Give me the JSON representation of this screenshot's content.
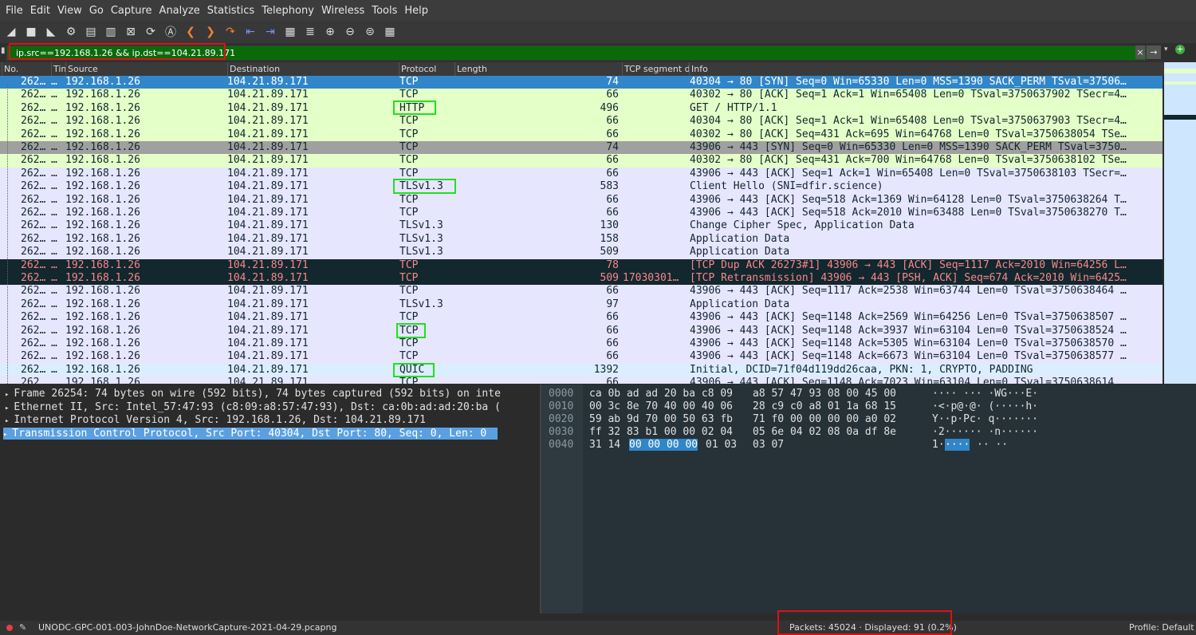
{
  "menu": [
    "File",
    "Edit",
    "View",
    "Go",
    "Capture",
    "Analyze",
    "Statistics",
    "Telephony",
    "Wireless",
    "Tools",
    "Help"
  ],
  "toolbar_icons": [
    "shark-fin-start-icon",
    "stop-icon",
    "restart-icon",
    "options-icon",
    "open-icon",
    "save-icon",
    "close-file-icon",
    "reload-icon",
    "find-icon",
    "back-icon",
    "forward-icon",
    "go-to-packet-icon",
    "first-packet-icon",
    "last-packet-icon",
    "autoscroll-icon",
    "colorize-icon",
    "zoom-in-icon",
    "zoom-out-icon",
    "normal-size-icon",
    "resize-columns-icon"
  ],
  "filter": {
    "value": "ip.src==192.168.1.26 && ip.dst==104.21.89.171",
    "clear": "×",
    "apply": "→",
    "add": "+"
  },
  "columns": [
    "No.",
    "Time",
    "Source",
    "Destination",
    "Protocol",
    "Length",
    "TCP segment data",
    "Info"
  ],
  "packets": [
    {
      "no": "262…",
      "time": "…",
      "src": "192.168.1.26",
      "dst": "104.21.89.171",
      "proto": "TCP",
      "len": "74",
      "seg": "",
      "info": "40304 → 80 [SYN] Seq=0 Win=65330 Len=0 MSS=1390 SACK_PERM TSval=37506…",
      "style": "sel"
    },
    {
      "no": "262…",
      "time": "…",
      "src": "192.168.1.26",
      "dst": "104.21.89.171",
      "proto": "TCP",
      "len": "66",
      "seg": "",
      "info": "40302 → 80 [ACK] Seq=1 Ack=1 Win=65408 Len=0 TSval=3750637902 TSecr=4…",
      "style": "green"
    },
    {
      "no": "262…",
      "time": "…",
      "src": "192.168.1.26",
      "dst": "104.21.89.171",
      "proto": "HTTP",
      "len": "496",
      "seg": "",
      "info": "GET / HTTP/1.1",
      "style": "green"
    },
    {
      "no": "262…",
      "time": "…",
      "src": "192.168.1.26",
      "dst": "104.21.89.171",
      "proto": "TCP",
      "len": "66",
      "seg": "",
      "info": "40304 → 80 [ACK] Seq=1 Ack=1 Win=65408 Len=0 TSval=3750637903 TSecr=4…",
      "style": "green"
    },
    {
      "no": "262…",
      "time": "…",
      "src": "192.168.1.26",
      "dst": "104.21.89.171",
      "proto": "TCP",
      "len": "66",
      "seg": "",
      "info": "40302 → 80 [ACK] Seq=431 Ack=695 Win=64768 Len=0 TSval=3750638054 TSe…",
      "style": "green"
    },
    {
      "no": "262…",
      "time": "…",
      "src": "192.168.1.26",
      "dst": "104.21.89.171",
      "proto": "TCP",
      "len": "74",
      "seg": "",
      "info": "43906 → 443 [SYN] Seq=0 Win=65330 Len=0 MSS=1390 SACK_PERM TSval=3750…",
      "style": "gray"
    },
    {
      "no": "262…",
      "time": "…",
      "src": "192.168.1.26",
      "dst": "104.21.89.171",
      "proto": "TCP",
      "len": "66",
      "seg": "",
      "info": "40302 → 80 [ACK] Seq=431 Ack=700 Win=64768 Len=0 TSval=3750638102 TSe…",
      "style": "green"
    },
    {
      "no": "262…",
      "time": "…",
      "src": "192.168.1.26",
      "dst": "104.21.89.171",
      "proto": "TCP",
      "len": "66",
      "seg": "",
      "info": "43906 → 443 [ACK] Seq=1 Ack=1 Win=65408 Len=0 TSval=3750638103 TSecr=…",
      "style": "lav"
    },
    {
      "no": "262…",
      "time": "…",
      "src": "192.168.1.26",
      "dst": "104.21.89.171",
      "proto": "TLSv1.3",
      "len": "583",
      "seg": "",
      "info": "Client Hello (SNI=dfir.science)",
      "style": "lav"
    },
    {
      "no": "262…",
      "time": "…",
      "src": "192.168.1.26",
      "dst": "104.21.89.171",
      "proto": "TCP",
      "len": "66",
      "seg": "",
      "info": "43906 → 443 [ACK] Seq=518 Ack=1369 Win=64128 Len=0 TSval=3750638264 T…",
      "style": "lav"
    },
    {
      "no": "262…",
      "time": "…",
      "src": "192.168.1.26",
      "dst": "104.21.89.171",
      "proto": "TCP",
      "len": "66",
      "seg": "",
      "info": "43906 → 443 [ACK] Seq=518 Ack=2010 Win=63488 Len=0 TSval=3750638270 T…",
      "style": "lav"
    },
    {
      "no": "262…",
      "time": "…",
      "src": "192.168.1.26",
      "dst": "104.21.89.171",
      "proto": "TLSv1.3",
      "len": "130",
      "seg": "",
      "info": "Change Cipher Spec, Application Data",
      "style": "lav"
    },
    {
      "no": "262…",
      "time": "…",
      "src": "192.168.1.26",
      "dst": "104.21.89.171",
      "proto": "TLSv1.3",
      "len": "158",
      "seg": "",
      "info": "Application Data",
      "style": "lav"
    },
    {
      "no": "262…",
      "time": "…",
      "src": "192.168.1.26",
      "dst": "104.21.89.171",
      "proto": "TLSv1.3",
      "len": "509",
      "seg": "",
      "info": "Application Data",
      "style": "lav"
    },
    {
      "no": "262…",
      "time": "…",
      "src": "192.168.1.26",
      "dst": "104.21.89.171",
      "proto": "TCP",
      "len": "78",
      "seg": "",
      "info": "[TCP Dup ACK 26273#1] 43906 → 443 [ACK] Seq=1117 Ack=2010 Win=64256 L…",
      "style": "dark"
    },
    {
      "no": "262…",
      "time": "…",
      "src": "192.168.1.26",
      "dst": "104.21.89.171",
      "proto": "TCP",
      "len": "509",
      "seg": "17030301…",
      "info": "[TCP Retransmission] 43906 → 443 [PSH, ACK] Seq=674 Ack=2010 Win=6425…",
      "style": "dark"
    },
    {
      "no": "262…",
      "time": "…",
      "src": "192.168.1.26",
      "dst": "104.21.89.171",
      "proto": "TCP",
      "len": "66",
      "seg": "",
      "info": "43906 → 443 [ACK] Seq=1117 Ack=2538 Win=63744 Len=0 TSval=3750638464 …",
      "style": "lav"
    },
    {
      "no": "262…",
      "time": "…",
      "src": "192.168.1.26",
      "dst": "104.21.89.171",
      "proto": "TLSv1.3",
      "len": "97",
      "seg": "",
      "info": "Application Data",
      "style": "lav"
    },
    {
      "no": "262…",
      "time": "…",
      "src": "192.168.1.26",
      "dst": "104.21.89.171",
      "proto": "TCP",
      "len": "66",
      "seg": "",
      "info": "43906 → 443 [ACK] Seq=1148 Ack=2569 Win=64256 Len=0 TSval=3750638507 …",
      "style": "lav"
    },
    {
      "no": "262…",
      "time": "…",
      "src": "192.168.1.26",
      "dst": "104.21.89.171",
      "proto": "TCP",
      "len": "66",
      "seg": "",
      "info": "43906 → 443 [ACK] Seq=1148 Ack=3937 Win=63104 Len=0 TSval=3750638524 …",
      "style": "lav"
    },
    {
      "no": "262…",
      "time": "…",
      "src": "192.168.1.26",
      "dst": "104.21.89.171",
      "proto": "TCP",
      "len": "66",
      "seg": "",
      "info": "43906 → 443 [ACK] Seq=1148 Ack=5305 Win=63104 Len=0 TSval=3750638570 …",
      "style": "lav"
    },
    {
      "no": "262…",
      "time": "…",
      "src": "192.168.1.26",
      "dst": "104.21.89.171",
      "proto": "TCP",
      "len": "66",
      "seg": "",
      "info": "43906 → 443 [ACK] Seq=1148 Ack=6673 Win=63104 Len=0 TSval=3750638577 …",
      "style": "lav"
    },
    {
      "no": "262…",
      "time": "…",
      "src": "192.168.1.26",
      "dst": "104.21.89.171",
      "proto": "QUIC",
      "len": "1392",
      "seg": "",
      "info": "Initial, DCID=71f04d119dd26caa, PKN: 1, CRYPTO, PADDING",
      "style": "blue"
    },
    {
      "no": "262…",
      "time": "…",
      "src": "192.168.1.26",
      "dst": "104.21.89.171",
      "proto": "TCP",
      "len": "66",
      "seg": "",
      "info": "43906 → 443 [ACK] Seq=1148 Ack=7023 Win=63104 Len=0 TSval=3750638614 …",
      "style": "lav"
    }
  ],
  "details": [
    "Frame 26254: 74 bytes on wire (592 bits), 74 bytes captured (592 bits) on inte",
    "Ethernet II, Src: Intel_57:47:93 (c8:09:a8:57:47:93), Dst: ca:0b:ad:ad:20:ba (",
    "Internet Protocol Version 4, Src: 192.168.1.26, Dst: 104.21.89.171",
    "Transmission Control Protocol, Src Port: 40304, Dst Port: 80, Seq: 0, Len: 0"
  ],
  "hex": [
    {
      "off": "0000",
      "a": "ca 0b ad ad 20 ba c8 09",
      "b": "a8 57 47 93 08 00 45 00",
      "ascii": "···· ··· ·WG···E·"
    },
    {
      "off": "0010",
      "a": "00 3c 8e 70 40 00 40 06",
      "b": "28 c9 c0 a8 01 1a 68 15",
      "ascii": "·<·p@·@· (·····h·"
    },
    {
      "off": "0020",
      "a": "59 ab 9d 70 00 50 63 fb",
      "b": "71 f0 00 00 00 00 a0 02",
      "ascii": "Y··p·Pc· q·······"
    },
    {
      "off": "0030",
      "a": "ff 32 83 b1 00 00 02 04",
      "b": "05 6e 04 02 08 0a df 8e",
      "ascii": "·2······ ·n······"
    },
    {
      "off": "0040",
      "a": "31 14",
      "hl": "00 00 00 00",
      "a2": "01 03",
      "b": "03 07",
      "ascii1": "1·",
      "asciihl": "····",
      "ascii2": "·· ··"
    }
  ],
  "status": {
    "file": "UNODC-GPC-001-003-JohnDoe-NetworkCapture-2021-04-29.pcapng",
    "packets": "Packets: 45024 · Displayed: 91 (0.2%)",
    "profile": "Profile: Default"
  },
  "colors": {
    "selected": "#3086c8",
    "green": "#e4ffc7",
    "lavender": "#e7e6ff",
    "gray": "#a0a0a0",
    "dark": "#12272e",
    "dark_text": "#f78787",
    "quic": "#daeeff",
    "filter_bg": "#0a6a0a",
    "annotation_red": "#e01010",
    "annotation_green": "#20e020"
  }
}
